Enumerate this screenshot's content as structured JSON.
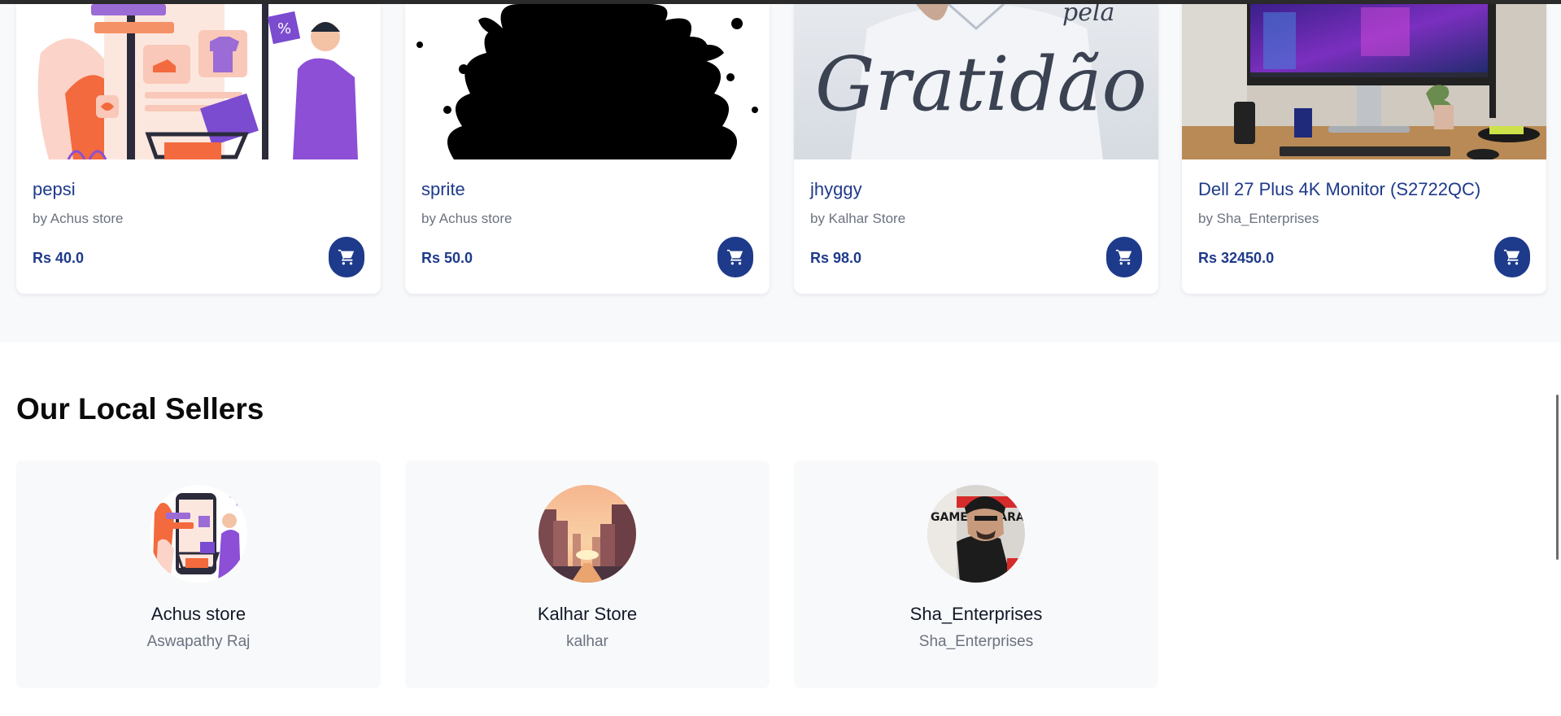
{
  "products": [
    {
      "name": "pepsi",
      "seller": "by Achus store",
      "price": "Rs 40.0",
      "image_icon": "shopping-illustration-icon",
      "cart_icon": "cart-icon"
    },
    {
      "name": "sprite",
      "seller": "by Achus store",
      "price": "Rs 50.0",
      "image_icon": "ink-splash-icon",
      "cart_icon": "cart-icon"
    },
    {
      "name": "jhyggy",
      "seller": "by Kalhar Store",
      "price": "Rs 98.0",
      "image_icon": "gratidao-shirt-photo",
      "image_text": "Gratidão",
      "image_text_small": "pela",
      "cart_icon": "cart-icon"
    },
    {
      "name": "Dell 27 Plus 4K Monitor (S2722QC)",
      "seller": "by Sha_Enterprises",
      "price": "Rs 32450.0",
      "image_icon": "monitor-desk-photo",
      "cart_icon": "cart-icon"
    }
  ],
  "sellers_section": {
    "title": "Our Local Sellers"
  },
  "sellers": [
    {
      "name": "Achus store",
      "owner": "Aswapathy Raj",
      "avatar_icon": "shopping-illustration-avatar"
    },
    {
      "name": "Kalhar Store",
      "owner": "kalhar",
      "avatar_icon": "city-sunset-avatar"
    },
    {
      "name": "Sha_Enterprises",
      "owner": "Sha_Enterprises",
      "avatar_icon": "gamer-portrait-avatar",
      "avatar_text": "GAMER SHARA"
    }
  ],
  "colors": {
    "accent": "#1e3a8a",
    "muted_text": "#6b7280",
    "section_background": "#f8f9fb"
  }
}
